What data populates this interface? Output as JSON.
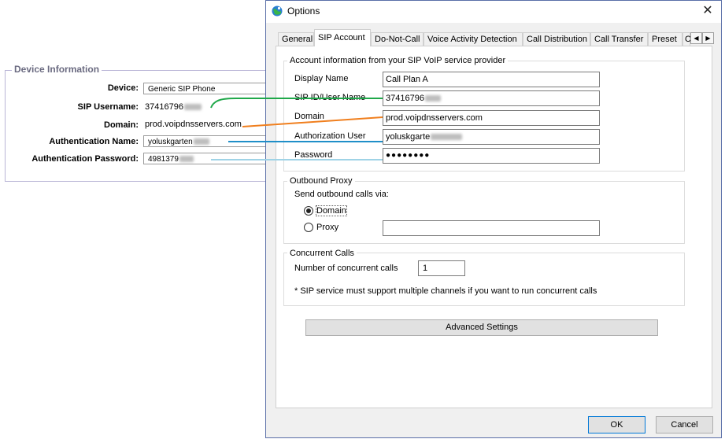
{
  "device_panel": {
    "legend": "Device Information",
    "rows": [
      {
        "label": "Device:",
        "value": "Generic SIP Phone"
      },
      {
        "label": "SIP Username:",
        "value": "37416796"
      },
      {
        "label": "Domain:",
        "value": "prod.voipdnsservers.com"
      },
      {
        "label": "Authentication Name:",
        "value": "yoluskgarten"
      },
      {
        "label": "Authentication Password:",
        "value": "4981379"
      }
    ]
  },
  "dialog": {
    "title": "Options",
    "close": "✕",
    "tabs": [
      "General",
      "SIP Account",
      "Do-Not-Call",
      "Voice Activity Detection",
      "Call Distribution",
      "Call Transfer",
      "Preset",
      "C"
    ],
    "active_tab": "SIP Account",
    "scroll_left": "◀",
    "scroll_right": "▶",
    "account": {
      "group_title": "Account information from your SIP VoIP service provider",
      "fields": [
        {
          "label": "Display Name",
          "value": "Call Plan A"
        },
        {
          "label": "SIP ID/User Name",
          "value": "37416796"
        },
        {
          "label": "Domain",
          "value": "prod.voipdnsservers.com"
        },
        {
          "label": "Authorization User",
          "value": "yoluskgarte"
        },
        {
          "label": "Password",
          "value": "●●●●●●●●"
        }
      ]
    },
    "proxy": {
      "group_title": "Outbound Proxy",
      "send_via": "Send outbound calls via:",
      "option_domain": "Domain",
      "option_proxy": "Proxy",
      "selected": "Domain",
      "proxy_value": ""
    },
    "concurrent": {
      "group_title": "Concurrent Calls",
      "label": "Number of concurrent calls",
      "value": "1",
      "note": "* SIP service must support multiple channels if you want to run concurrent calls"
    },
    "advanced_button": "Advanced Settings",
    "ok_button": "OK",
    "cancel_button": "Cancel"
  },
  "connector_colors": {
    "sip_id": "#1fa84a",
    "domain": "#f07f1e",
    "auth_user": "#1f8fc8",
    "password": "#9fd3e6"
  }
}
